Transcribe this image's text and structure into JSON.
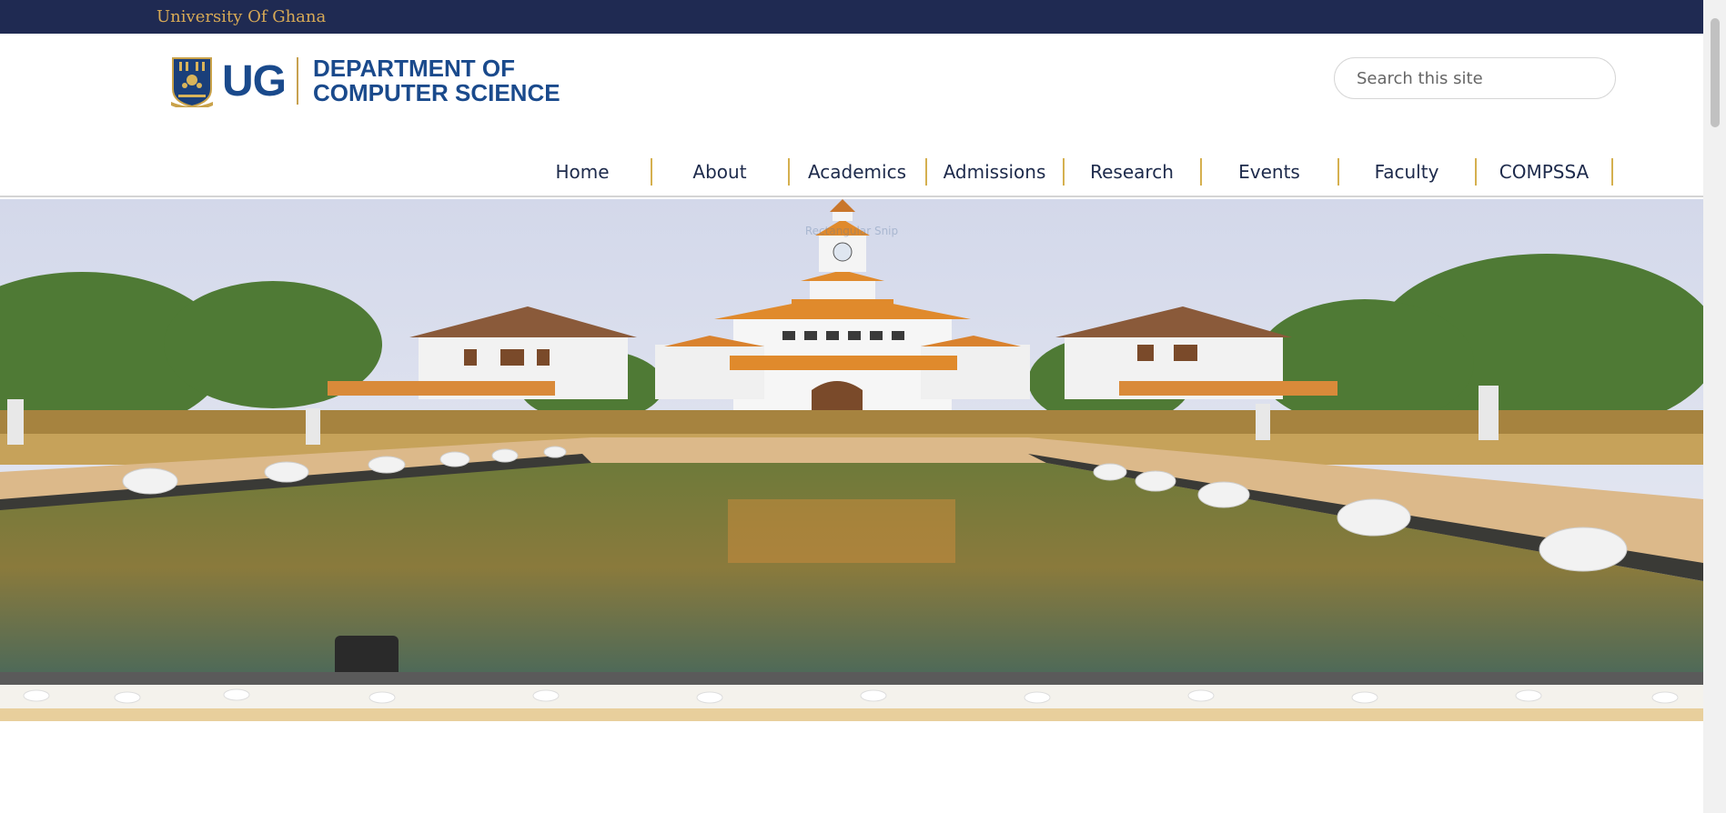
{
  "topbar": {
    "university": "University Of Ghana"
  },
  "brand": {
    "abbr": "UG",
    "dept_line1": "DEPARTMENT OF",
    "dept_line2": "COMPUTER SCIENCE"
  },
  "search": {
    "placeholder": "Search this site"
  },
  "nav": {
    "items": [
      {
        "label": "Home"
      },
      {
        "label": "About"
      },
      {
        "label": "Academics"
      },
      {
        "label": "Admissions"
      },
      {
        "label": "Research"
      },
      {
        "label": "Events"
      },
      {
        "label": "Faculty"
      },
      {
        "label": "COMPSSA"
      }
    ]
  },
  "hero": {
    "overlay_text": "Rectangular Snip"
  },
  "colors": {
    "topbar": "#1f2a52",
    "gold": "#d8aa56",
    "brand_blue": "#1a4a8c",
    "nav_separator": "#d5b04f"
  }
}
